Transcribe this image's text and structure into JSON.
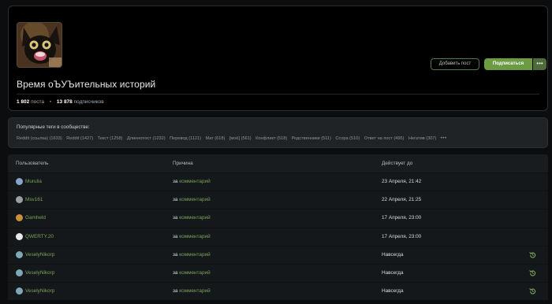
{
  "community": {
    "title": "Время оЪУЪительных историй",
    "posts_count": "1 802",
    "posts_label": "поста",
    "subscribers_count": "13 878",
    "subscribers_label": "подписчиков",
    "add_post_label": "Добавить пост",
    "subscribe_label": "Подписаться",
    "more_label": "•••"
  },
  "tags": {
    "title": "Популярные теги в сообществе:",
    "items": [
      "Reddit (ссылка) (1633)",
      "Reddit (1427)",
      "Текст (1258)",
      "Длиннопост (1232)",
      "Перевод (1121)",
      "Мат (618)",
      "[моё] (561)",
      "Конфликт (518)",
      "Родственники (511)",
      "Ссора (510)",
      "Ответ на пост (495)",
      "Негатив (307)"
    ],
    "more": "•••"
  },
  "table": {
    "headers": {
      "user": "Пользователь",
      "reason": "Причина",
      "until": "Действует до"
    },
    "reason_prefix": "за",
    "reason_link": "комментарий",
    "rows": [
      {
        "user": "Murulia",
        "until": "23 Апреля, 21:42",
        "avatar_color": "#8aa4c8",
        "restorable": false
      },
      {
        "user": "Msv161",
        "until": "22 Апреля, 21:25",
        "avatar_color": "#9a9fa6",
        "restorable": false
      },
      {
        "user": "Gamheld",
        "until": "17 Апреля, 23:00",
        "avatar_color": "#c98f3c",
        "restorable": false
      },
      {
        "user": "QWERTY.20",
        "until": "17 Апреля, 23:00",
        "avatar_color": "#e9e9e9",
        "restorable": false
      },
      {
        "user": "VeselyNikorp",
        "until": "Навсегда",
        "avatar_color": "#7fa7b5",
        "restorable": true
      },
      {
        "user": "VeselyNikorp",
        "until": "Навсегда",
        "avatar_color": "#7fa7b5",
        "restorable": true
      },
      {
        "user": "VeselyNikorp",
        "until": "Навсегда",
        "avatar_color": "#7fa7b5",
        "restorable": true
      }
    ]
  },
  "colors": {
    "accent_green": "#6b9b43",
    "link_green": "#7aa15b",
    "background": "#0b0d0e"
  }
}
